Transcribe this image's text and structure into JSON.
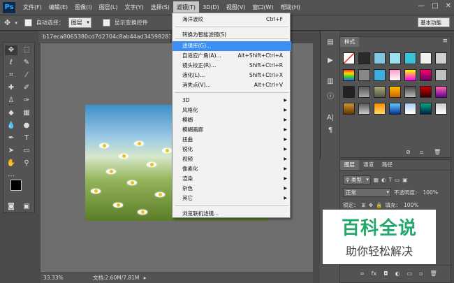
{
  "app": {
    "logo": "Ps"
  },
  "menubar": {
    "items": [
      "文件(F)",
      "编辑(E)",
      "图像(I)",
      "图层(L)",
      "文字(Y)",
      "选择(S)",
      "滤镜(T)",
      "3D(D)",
      "视图(V)",
      "窗口(W)",
      "帮助(H)"
    ],
    "active_index": 6,
    "window_controls": [
      "—",
      "□",
      "✕"
    ]
  },
  "options": {
    "auto_select_label": "自动选择：",
    "auto_select_value": "图层",
    "show_transform_label": "显示变换控件",
    "workspace": "基本功能"
  },
  "document": {
    "tab_title": "b17eca8065380cd7d2704c8ab44ad34598281de.jp",
    "zoom": "33.33%",
    "doc_info": "文档:2.60M/7.81M"
  },
  "filter_menu": {
    "items": [
      {
        "label": "海洋波纹",
        "shortcut": "Ctrl+F"
      },
      {
        "label": "转换为智能滤镜(S)"
      },
      {
        "label": "滤镜库(G)...",
        "highlighted": true
      },
      {
        "label": "自适应广角(A)...",
        "shortcut": "Alt+Shift+Ctrl+A"
      },
      {
        "label": "镜头校正(R)...",
        "shortcut": "Shift+Ctrl+R"
      },
      {
        "label": "液化(L)...",
        "shortcut": "Shift+Ctrl+X"
      },
      {
        "label": "消失点(V)...",
        "shortcut": "Alt+Ctrl+V"
      },
      {
        "label": "3D",
        "submenu": true
      },
      {
        "label": "风格化",
        "submenu": true
      },
      {
        "label": "模糊",
        "submenu": true
      },
      {
        "label": "模糊画廊",
        "submenu": true
      },
      {
        "label": "扭曲",
        "submenu": true
      },
      {
        "label": "锐化",
        "submenu": true
      },
      {
        "label": "视频",
        "submenu": true
      },
      {
        "label": "像素化",
        "submenu": true
      },
      {
        "label": "渲染",
        "submenu": true
      },
      {
        "label": "杂色",
        "submenu": true
      },
      {
        "label": "其它",
        "submenu": true
      },
      {
        "label": "浏览联机滤镜..."
      }
    ],
    "submenu_arrow": "▶"
  },
  "styles_panel": {
    "tab": "样式"
  },
  "layers_panel": {
    "tabs": [
      "图层",
      "通道",
      "路径"
    ],
    "kind_label": "类型",
    "blend_mode": "正常",
    "opacity_label": "不透明度：",
    "opacity_value": "100%",
    "lock_label": "锁定：",
    "fill_label": "填充：",
    "fill_value": "100%"
  },
  "watermark": {
    "title": "百科全说",
    "subtitle": "助你轻松解决"
  },
  "colors": {
    "accent": "#3c8ff2",
    "brand_green": "#23a76b"
  }
}
